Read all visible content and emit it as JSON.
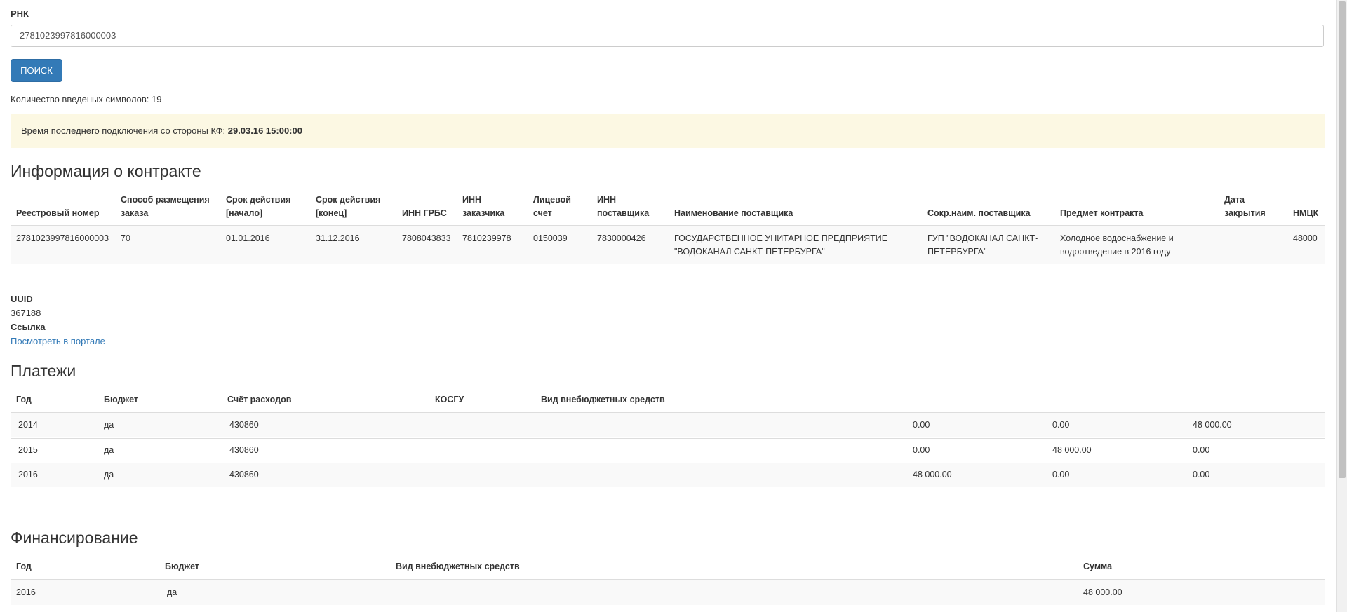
{
  "search": {
    "label": "РНК",
    "value": "2781023997816000003",
    "button": "ПОИСК",
    "count_text": "Количество введеных символов: 19"
  },
  "alert": {
    "text": "Время последнего подключения со стороны КФ: ",
    "time": "29.03.16 15:00:00"
  },
  "contract": {
    "title": "Информация о контракте",
    "headers": [
      [
        "Реестровый номер"
      ],
      [
        "Способ размещения",
        "заказа"
      ],
      [
        "Срок действия",
        "[начало]"
      ],
      [
        "Срок действия",
        "[конец]"
      ],
      [
        "ИНН ГРБС"
      ],
      [
        "ИНН",
        "заказчика"
      ],
      [
        "Лицевой",
        "счет"
      ],
      [
        "ИНН",
        "поставщика"
      ],
      [
        "Наименование поставщика"
      ],
      [
        "Сокр.наим. поставщика"
      ],
      [
        "Предмет контракта"
      ],
      [
        "Дата",
        "закрытия"
      ],
      [
        "НМЦК"
      ]
    ],
    "row": [
      [
        "2781023997816000003"
      ],
      [
        "70"
      ],
      [
        "01.01.2016"
      ],
      [
        "31.12.2016"
      ],
      [
        "7808043833"
      ],
      [
        "7810239978"
      ],
      [
        "0150039"
      ],
      [
        "7830000426"
      ],
      [
        "ГОСУДАРСТВЕННОЕ УНИТАРНОЕ ПРЕДПРИЯТИЕ",
        "\"ВОДОКАНАЛ САНКТ-ПЕТЕРБУРГА\""
      ],
      [
        "ГУП \"ВОДОКАНАЛ САНКТ-",
        "ПЕТЕРБУРГА\""
      ],
      [
        "Холодное водоснабжение и",
        "водоотведение в 2016 году"
      ],
      [
        ""
      ],
      [
        "48000"
      ]
    ]
  },
  "meta": {
    "uuid_label": "UUID",
    "uuid_value": "367188",
    "link_label": "Ссылка",
    "link_text": "Посмотреть в портале"
  },
  "payments": {
    "title": "Платежи",
    "headers": [
      "Год",
      "Бюджет",
      "Счёт расходов",
      "КОСГУ",
      "Вид внебюджетных средств"
    ],
    "rows": [
      [
        "2014",
        "да",
        "430860",
        "",
        "",
        "0.00",
        "0.00",
        "48 000.00"
      ],
      [
        "2015",
        "да",
        "430860",
        "",
        "",
        "0.00",
        "48 000.00",
        "0.00"
      ],
      [
        "2016",
        "да",
        "430860",
        "",
        "",
        "48 000.00",
        "0.00",
        "0.00"
      ]
    ]
  },
  "financing": {
    "title": "Финансирование",
    "headers": [
      "Год",
      "Бюджет",
      "Вид внебюджетных средств",
      "Сумма"
    ],
    "rows": [
      [
        "2016",
        "да",
        "",
        "48 000.00"
      ]
    ]
  }
}
